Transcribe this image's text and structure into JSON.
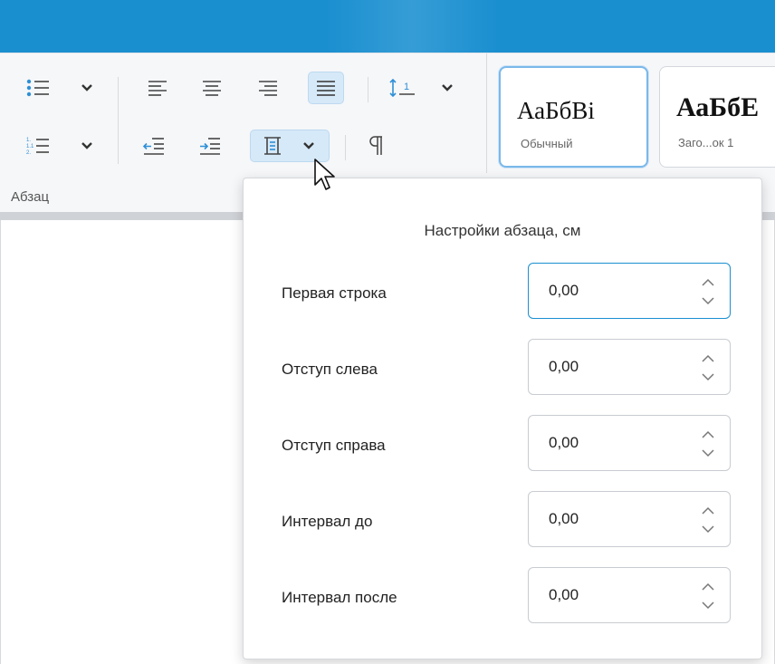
{
  "ribbon": {
    "group_label": "Абзац",
    "styles": [
      {
        "sample": "АаБбВі",
        "name": "Обычный",
        "selected": true
      },
      {
        "sample": "АаБбЕ",
        "name": "Заго...ок 1",
        "selected": false
      }
    ]
  },
  "popup": {
    "title": "Настройки абзаца, см",
    "fields": [
      {
        "label": "Первая строка",
        "value": "0,00"
      },
      {
        "label": "Отступ слева",
        "value": "0,00"
      },
      {
        "label": "Отступ справа",
        "value": "0,00"
      },
      {
        "label": "Интервал до",
        "value": "0,00"
      },
      {
        "label": "Интервал после",
        "value": "0,00"
      }
    ]
  },
  "line_spacing_icon_text": "1",
  "colors": {
    "accent": "#1a8fd0",
    "icon": "#2e8fd6"
  }
}
